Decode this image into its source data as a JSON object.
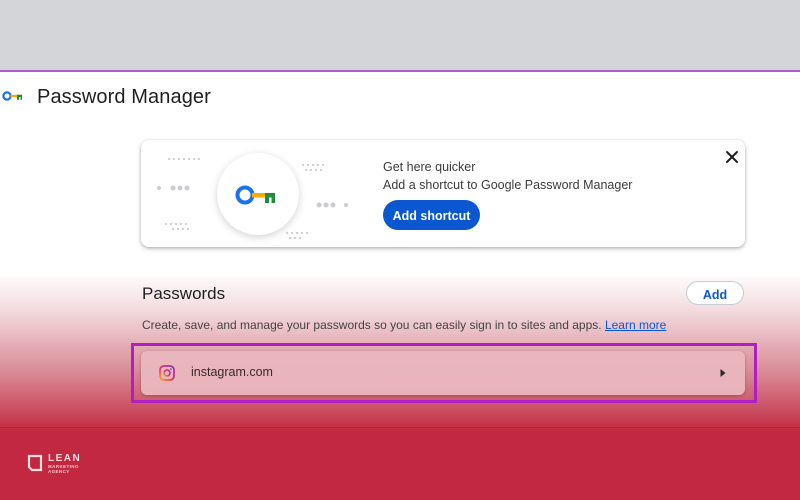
{
  "header": {
    "title": "Password Manager",
    "app_icon": "key-icon"
  },
  "promo": {
    "heading": "Get here quicker",
    "subtitle": "Add a shortcut to Google Password Manager",
    "button_label": "Add shortcut",
    "close_icon": "close-icon"
  },
  "passwords": {
    "title": "Passwords",
    "add_label": "Add",
    "description": "Create, save, and manage your passwords so you can easily sign in to sites and apps.",
    "learn_more": "Learn more",
    "items": [
      {
        "site": "instagram.com",
        "icon": "instagram-icon"
      }
    ]
  },
  "branding": {
    "name": "LEAN",
    "tagline": "MARKETING AGENCY"
  },
  "colors": {
    "accent": "#0b57d0",
    "highlight": "#b01fc4",
    "brand_red": "#c2283f"
  }
}
